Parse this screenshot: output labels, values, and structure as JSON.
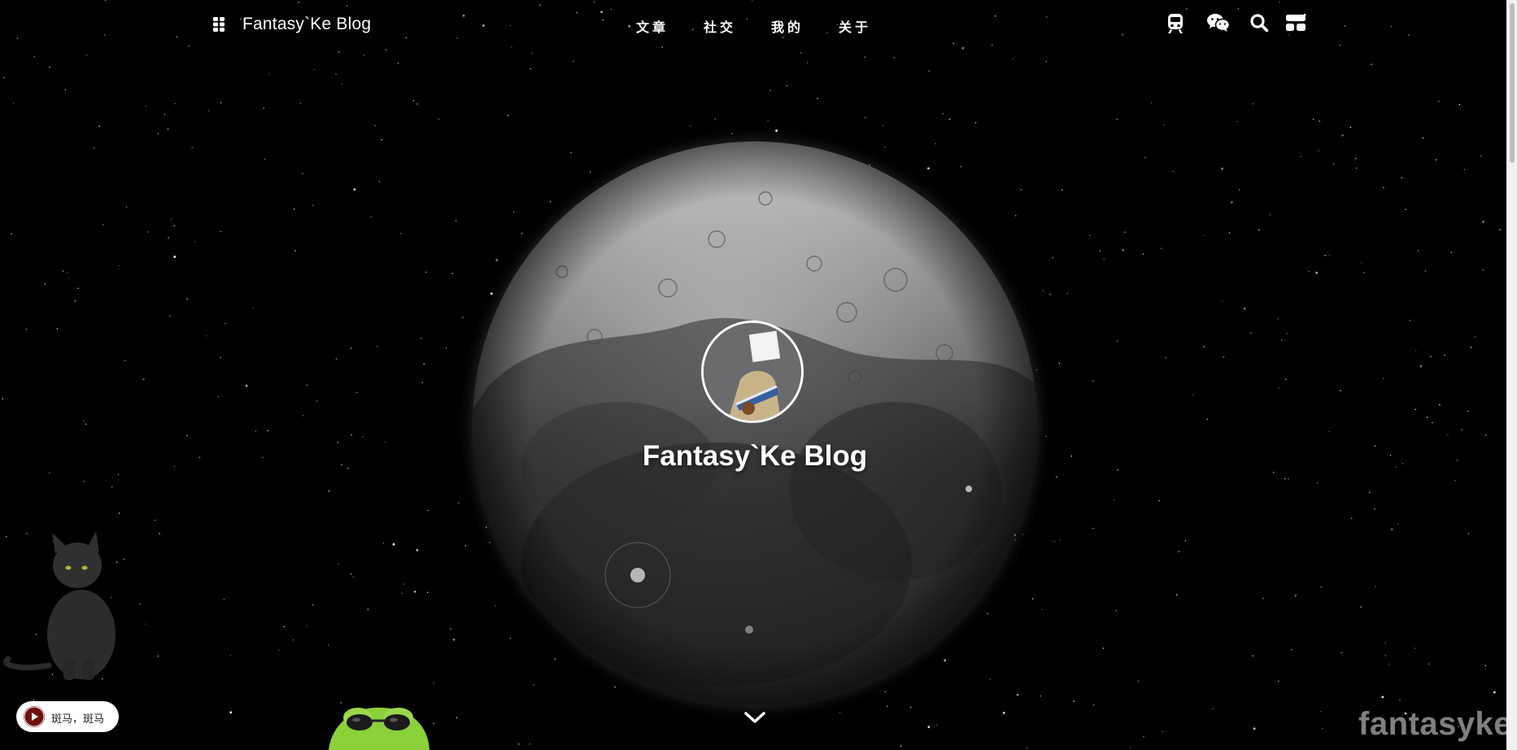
{
  "navbar": {
    "menu_icon": "grid-menu-icon",
    "site_title": "Fantasy`Ke Blog",
    "links": [
      {
        "label": "文章"
      },
      {
        "label": "社交"
      },
      {
        "label": "我的"
      },
      {
        "label": "关于"
      }
    ],
    "icons": [
      "train-icon",
      "wechat-icon",
      "search-icon",
      "layout-icon"
    ]
  },
  "hero": {
    "title": "Fantasy`Ke Blog",
    "scroll_icon": "chevron-down-icon"
  },
  "music": {
    "text": "斑马，斑马",
    "icon": "music-disc-icon"
  },
  "watermark": "fantasyke",
  "colors": {
    "background": "#000000",
    "text": "#ffffff",
    "pill": "#ffffff",
    "disc": "#6f1010"
  }
}
